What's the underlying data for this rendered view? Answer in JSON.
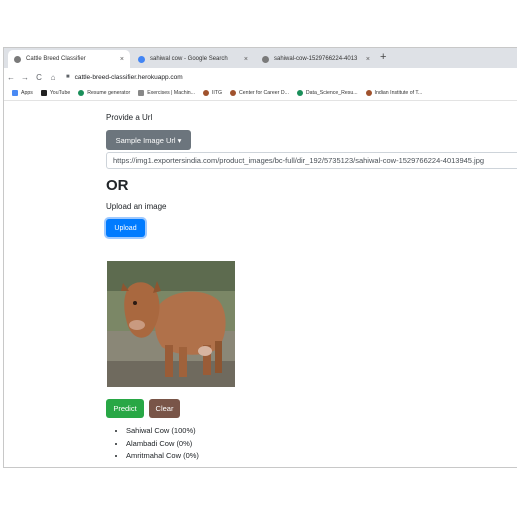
{
  "browser": {
    "tabs": [
      {
        "title": "Cattle Breed Classifier",
        "active": true,
        "close": "×"
      },
      {
        "title": "sahiwal cow - Google Search",
        "active": false,
        "close": "×"
      },
      {
        "title": "sahiwal-cow-1529766224-4013",
        "active": false,
        "close": "×"
      }
    ],
    "new_tab": "+",
    "nav": {
      "back": "←",
      "forward": "→",
      "reload": "C",
      "home": "⌂"
    },
    "url": "cattle-breed-classifier.herokuapp.com",
    "bookmarks": [
      "Apps",
      "YouTube",
      "Resume generator",
      "Exercises | Machin...",
      "IITG",
      "Center for Career D...",
      "Data_Science_Resu...",
      "Indian Institute of T..."
    ]
  },
  "page": {
    "provide_url_label": "Provide a Url",
    "sample_button": "Sample Image Url ▾",
    "url_value": "https://img1.exportersindia.com/product_images/bc-full/dir_192/5735123/sahiwal-cow-1529766224-4013945.jpg",
    "or_heading": "OR",
    "upload_label": "Upload an image",
    "upload_button": "Upload",
    "predict_button": "Predict",
    "clear_button": "Clear",
    "results": [
      "Sahiwal Cow (100%)",
      "Alambadi Cow (0%)",
      "Amritmahal Cow (0%)"
    ]
  },
  "colors": {
    "primary": "#007bff",
    "success": "#28a745",
    "secondary": "#6c757d",
    "clear": "#795548"
  }
}
